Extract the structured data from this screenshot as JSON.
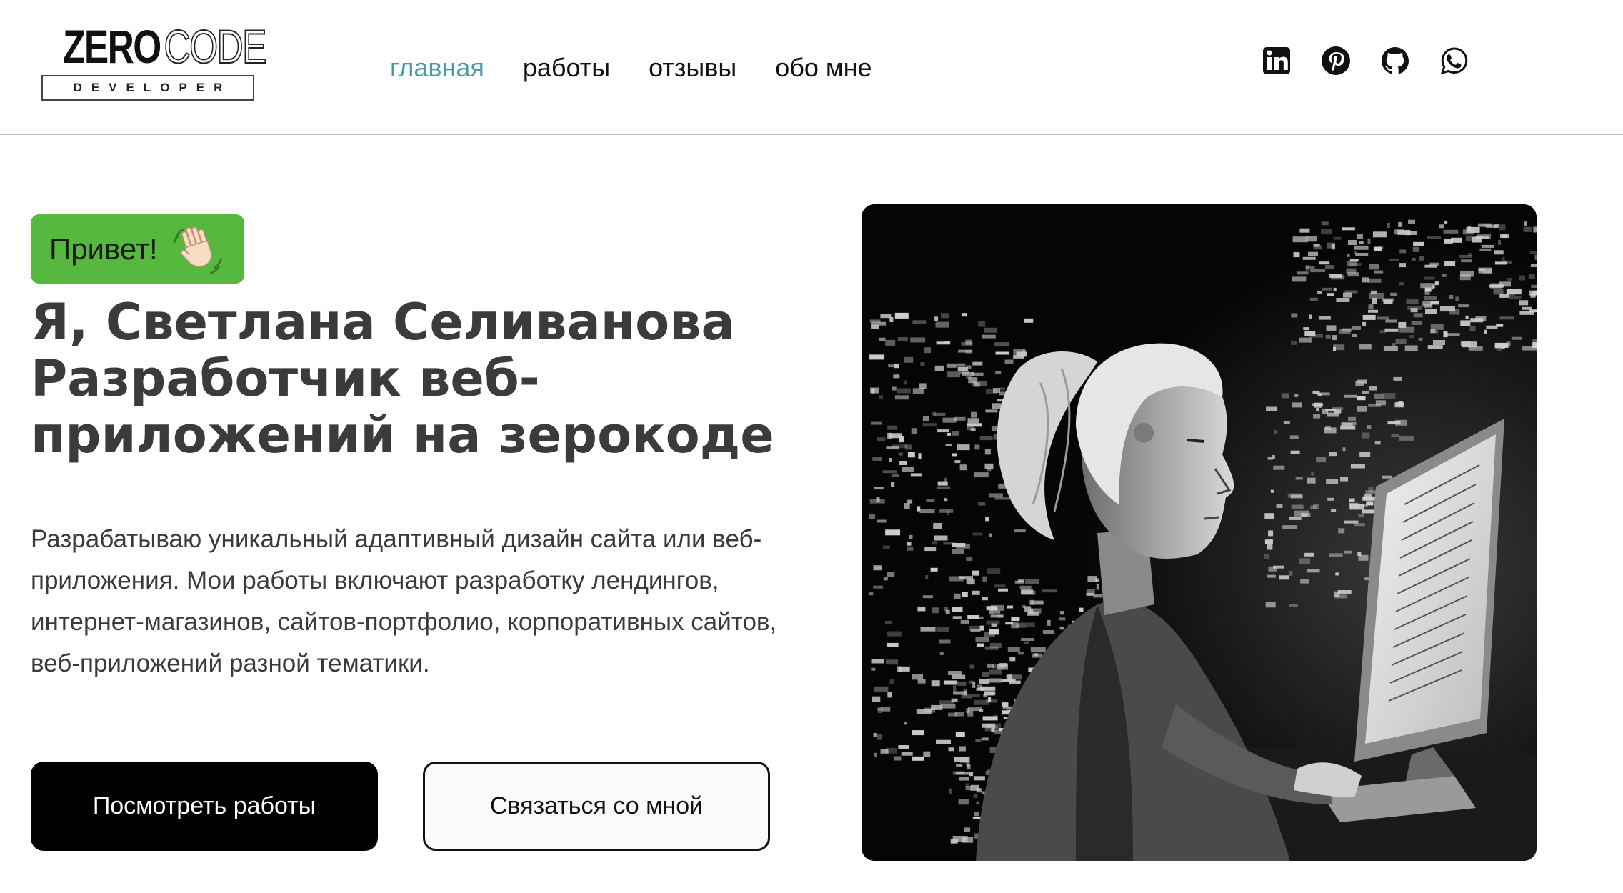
{
  "header": {
    "logo": {
      "word1": "ZERO",
      "word2": "CODE",
      "subtitle": "DEVELOPER"
    },
    "nav": [
      {
        "label": "главная",
        "active": true
      },
      {
        "label": "работы",
        "active": false
      },
      {
        "label": "отзывы",
        "active": false
      },
      {
        "label": "обо мне",
        "active": false
      }
    ],
    "socials": [
      "linkedin-icon",
      "pinterest-icon",
      "github-icon",
      "whatsapp-icon"
    ]
  },
  "hero": {
    "badge": {
      "text": "Привет!",
      "icon": "waving-hand-icon"
    },
    "title_lines": [
      "Я, Светлана Селиванова",
      "Разработчик веб-",
      "приложений на зерокоде"
    ],
    "description": "Разрабатываю уникальный адаптивный дизайн сайта или веб-приложения. Мои работы включают разработку лендингов, интернет-магазинов, сайтов-портфолио, корпоративных сайтов, веб-приложений разной тематики.",
    "primary_button": "Посмотреть работы",
    "secondary_button": "Связаться со мной",
    "image": "developer-illustration"
  },
  "colors": {
    "accent_nav": "#4d9aa6",
    "badge_green": "#56b83f",
    "title_gray": "#3b3b3b",
    "button_black": "#000000"
  }
}
